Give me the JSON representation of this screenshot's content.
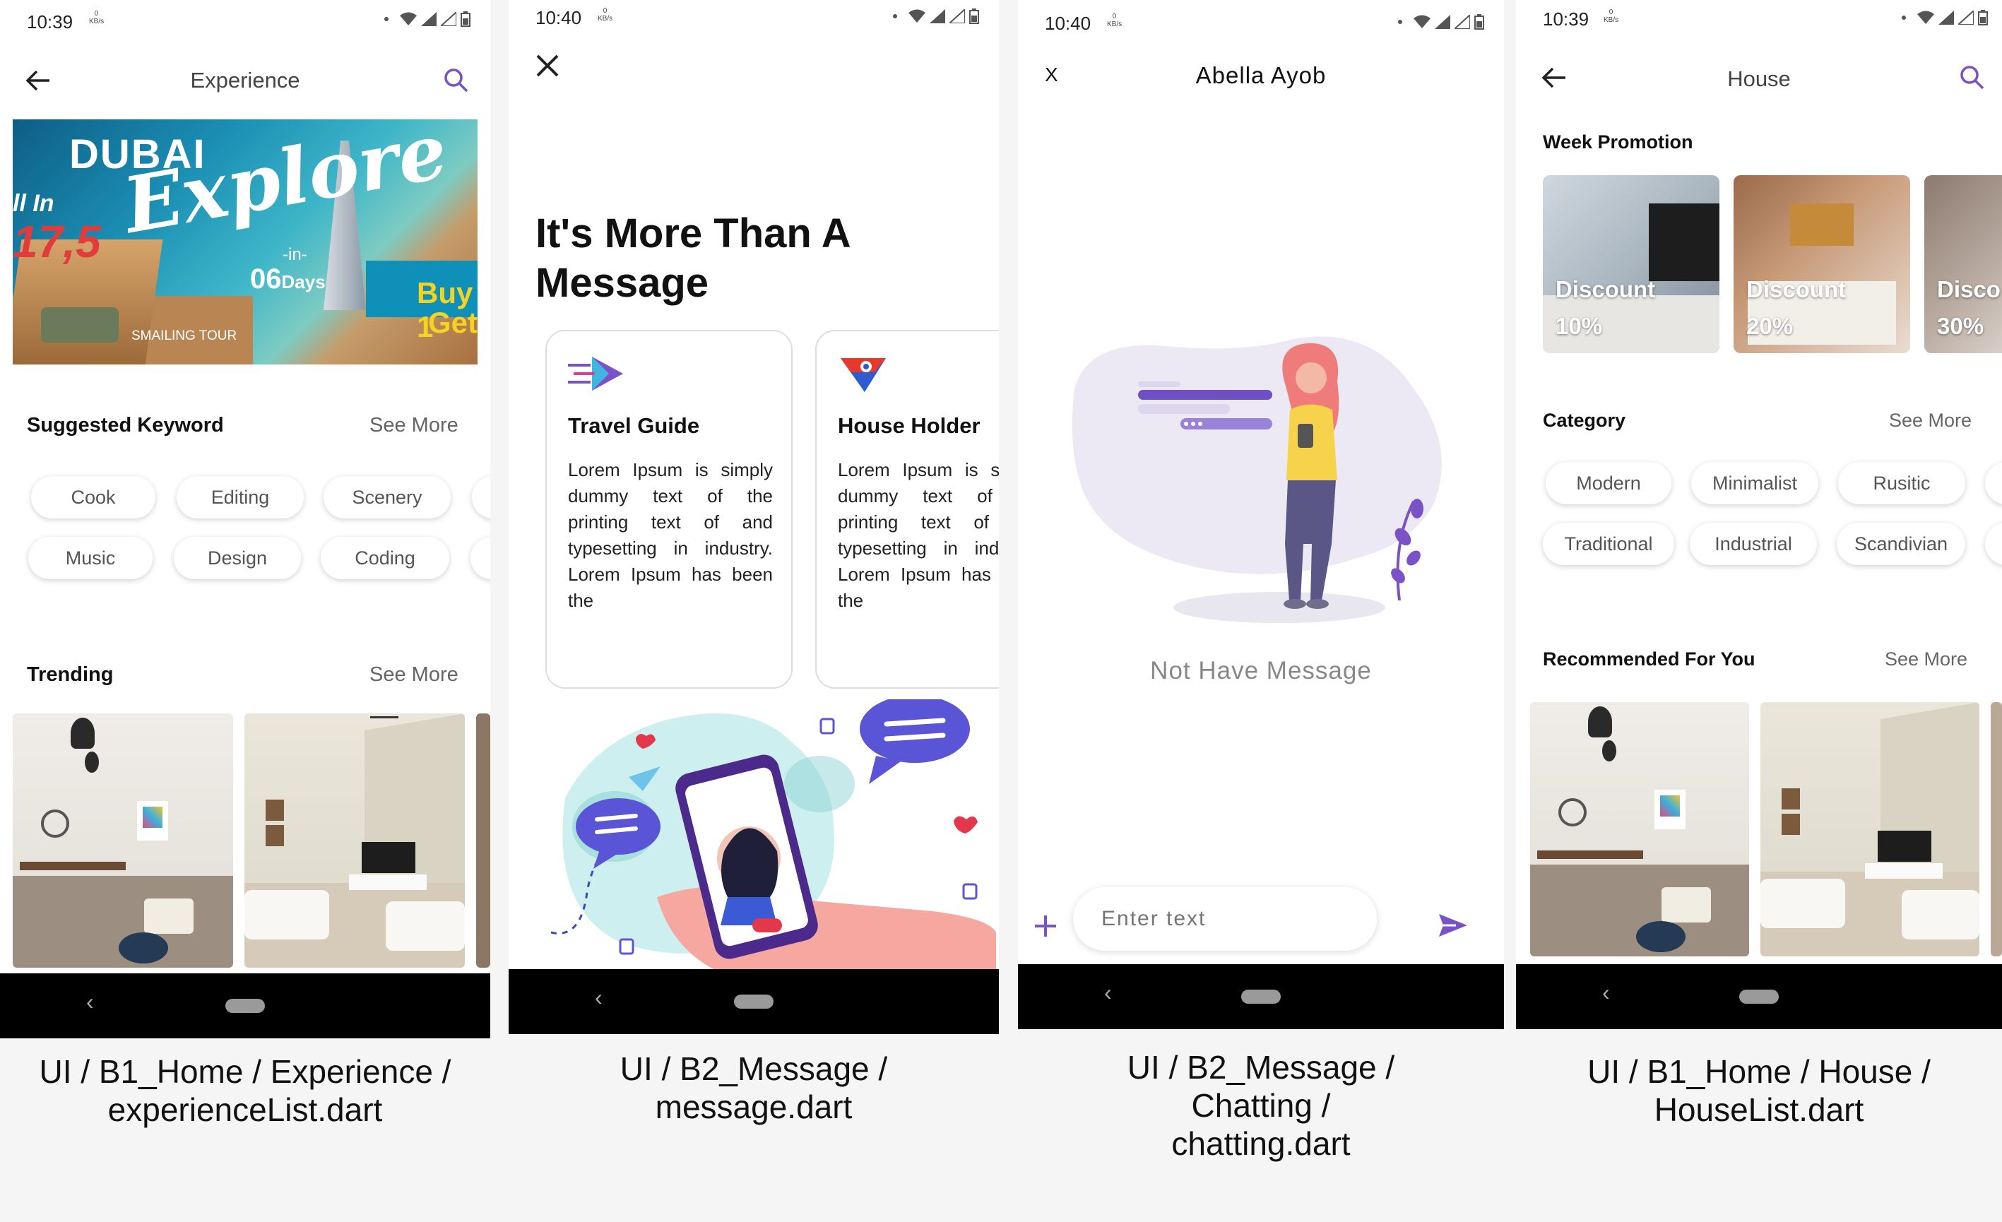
{
  "screens": {
    "experience": {
      "status": {
        "time": "10:39",
        "kb_value": "0",
        "kb_unit": "KB/s"
      },
      "title": "Experience",
      "banner": {
        "brand": "DUBAI",
        "headline": "Explore",
        "in": "-in-",
        "days_num": "06",
        "days_word": "Days",
        "left_line1": "ll In",
        "left_price": "17,5",
        "tour": "SMAILING TOUR",
        "buy": "Buy 1",
        "get": "Get"
      },
      "suggested_title": "Suggested Keyword",
      "suggested_more": "See More",
      "keywords_row1": [
        "Cook",
        "Editing",
        "Scenery"
      ],
      "keywords_row2": [
        "Music",
        "Design",
        "Coding"
      ],
      "trending_title": "Trending",
      "trending_more": "See More",
      "caption_line1": "UI / B1_Home / Experience /",
      "caption_line2": "experienceList.dart"
    },
    "message": {
      "status": {
        "time": "10:40",
        "kb_value": "0",
        "kb_unit": "KB/s"
      },
      "heading_line1": "It's More Than A",
      "heading_line2": "Message",
      "cards": [
        {
          "title": "Travel Guide",
          "body": "Lorem Ipsum is simply dummy text of the printing text of and typesetting in industry. Lorem Ipsum has been the"
        },
        {
          "title": "House Holder",
          "body": "Lorem Ipsum is simply dummy text of the printing text of and typesetting in industry. Lorem Ipsum has been the"
        }
      ],
      "caption_line1": "UI / B2_Message /",
      "caption_line2": "message.dart"
    },
    "chatting": {
      "status": {
        "time": "10:40",
        "kb_value": "0",
        "kb_unit": "KB/s"
      },
      "close": "X",
      "contact": "Abella Ayob",
      "empty_text": "Not Have Message",
      "input_placeholder": "Enter text",
      "caption_line1": "UI / B2_Message /",
      "caption_line2": "Chatting /",
      "caption_line3": "chatting.dart"
    },
    "house": {
      "status": {
        "time": "10:39",
        "kb_value": "0",
        "kb_unit": "KB/s"
      },
      "title": "House",
      "promo_title": "Week Promotion",
      "promos": [
        {
          "word": "Discount",
          "pct": "10%"
        },
        {
          "word": "Discount",
          "pct": "20%"
        },
        {
          "word": "Disco",
          "pct": "30%"
        }
      ],
      "category_title": "Category",
      "category_more": "See More",
      "categories_row1": [
        "Modern",
        "Minimalist",
        "Rusitic"
      ],
      "categories_row2": [
        "Traditional",
        "Industrial",
        "Scandivian"
      ],
      "recommended_title": "Recommended For You",
      "recommended_more": "See More",
      "caption_line1": "UI / B1_Home / House /",
      "caption_line2": "HouseList.dart"
    }
  },
  "colors": {
    "accent": "#7a52c7",
    "muted": "#888888"
  },
  "icons": [
    "back-arrow-icon",
    "search-icon",
    "close-icon",
    "plus-icon",
    "send-icon",
    "wifi-icon",
    "signal-icon",
    "battery-icon"
  ]
}
